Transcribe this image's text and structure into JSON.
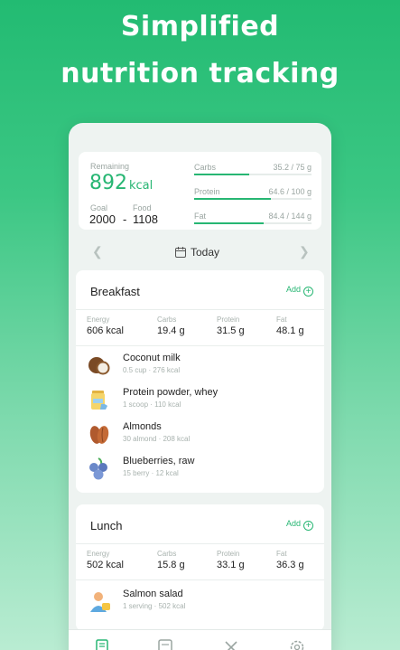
{
  "headline": {
    "line1": "Simplified",
    "line2": "nutrition tracking"
  },
  "summary": {
    "remaining_label": "Remaining",
    "remaining_value": "892",
    "remaining_unit": "kcal",
    "goal_label": "Goal",
    "goal_value": "2000",
    "separator": "-",
    "food_label": "Food",
    "food_value": "1108",
    "macros": [
      {
        "name": "Carbs",
        "value": "35.2 / 75 g",
        "fraction": 0.47
      },
      {
        "name": "Protein",
        "value": "64.6 / 100 g",
        "fraction": 0.65
      },
      {
        "name": "Fat",
        "value": "84.4 / 144 g",
        "fraction": 0.59
      }
    ]
  },
  "datebar": {
    "prev_icon": "chevron-left-icon",
    "label": "Today",
    "next_icon": "chevron-right-icon"
  },
  "meals": [
    {
      "title": "Breakfast",
      "add_label": "Add",
      "nutrients": [
        {
          "label": "Energy",
          "value": "606 kcal"
        },
        {
          "label": "Carbs",
          "value": "19.4 g"
        },
        {
          "label": "Protein",
          "value": "31.5 g"
        },
        {
          "label": "Fat",
          "value": "48.1 g"
        }
      ],
      "foods": [
        {
          "name": "Coconut milk",
          "detail": "0.5 cup · 276 kcal",
          "icon": "coconut-icon"
        },
        {
          "name": "Protein powder, whey",
          "detail": "1 scoop · 110 kcal",
          "icon": "protein-powder-icon"
        },
        {
          "name": "Almonds",
          "detail": "30 almond · 208 kcal",
          "icon": "almond-icon"
        },
        {
          "name": "Blueberries, raw",
          "detail": "15 berry · 12 kcal",
          "icon": "blueberry-icon"
        }
      ]
    },
    {
      "title": "Lunch",
      "add_label": "Add",
      "nutrients": [
        {
          "label": "Energy",
          "value": "502 kcal"
        },
        {
          "label": "Carbs",
          "value": "15.8 g"
        },
        {
          "label": "Protein",
          "value": "33.1 g"
        },
        {
          "label": "Fat",
          "value": "36.3 g"
        }
      ],
      "foods": [
        {
          "name": "Salmon salad",
          "detail": "1 serving · 502 kcal",
          "icon": "salmon-salad-icon"
        }
      ]
    }
  ],
  "tabbar": {
    "icons": [
      "diary-icon",
      "food-icon",
      "recipes-icon",
      "settings-icon"
    ]
  },
  "colors": {
    "accent": "#27b673",
    "background_top": "#22bb72",
    "background_bottom": "#b9ecd2"
  }
}
